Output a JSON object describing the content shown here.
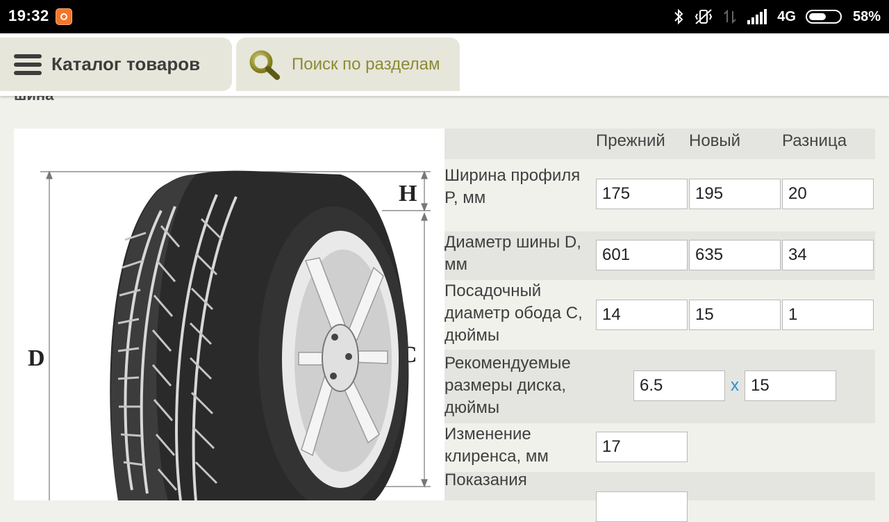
{
  "status_bar": {
    "time": "19:32",
    "network": "4G",
    "battery": "58%",
    "battery_level": 0.58
  },
  "toolbar": {
    "catalog_label": "Каталог товаров",
    "search_label": "Поиск по разделам"
  },
  "section": {
    "label": "шина"
  },
  "tire_image": {
    "labels": {
      "d": "D",
      "c": "C",
      "h": "H"
    }
  },
  "table": {
    "headers": {
      "prev": "Прежний",
      "new": "Новый",
      "diff": "Разница"
    },
    "rows": [
      {
        "label": "Ширина профиля P, мм",
        "prev": "175",
        "new": "195",
        "diff": "20"
      },
      {
        "label": "Диаметр шины D, мм",
        "prev": "601",
        "new": "635",
        "diff": "34"
      },
      {
        "label": "Посадочный диаметр обода C, дюймы",
        "prev": "14",
        "new": "15",
        "diff": "1"
      }
    ],
    "rim": {
      "label": "Рекомендуемые размеры диска, дюймы",
      "width": "6.5",
      "separator": "x",
      "diameter": "15"
    },
    "clearance": {
      "label": "Изменение клиренса, мм",
      "value": "17"
    },
    "speedometer": {
      "label": "Показания"
    }
  },
  "colors": {
    "status_bar": "#000000",
    "toolbar_button": "#e6e6da",
    "search_text": "#8d8a35",
    "row_shade": "#e4e4e0",
    "separator": "#2a8fd1"
  }
}
